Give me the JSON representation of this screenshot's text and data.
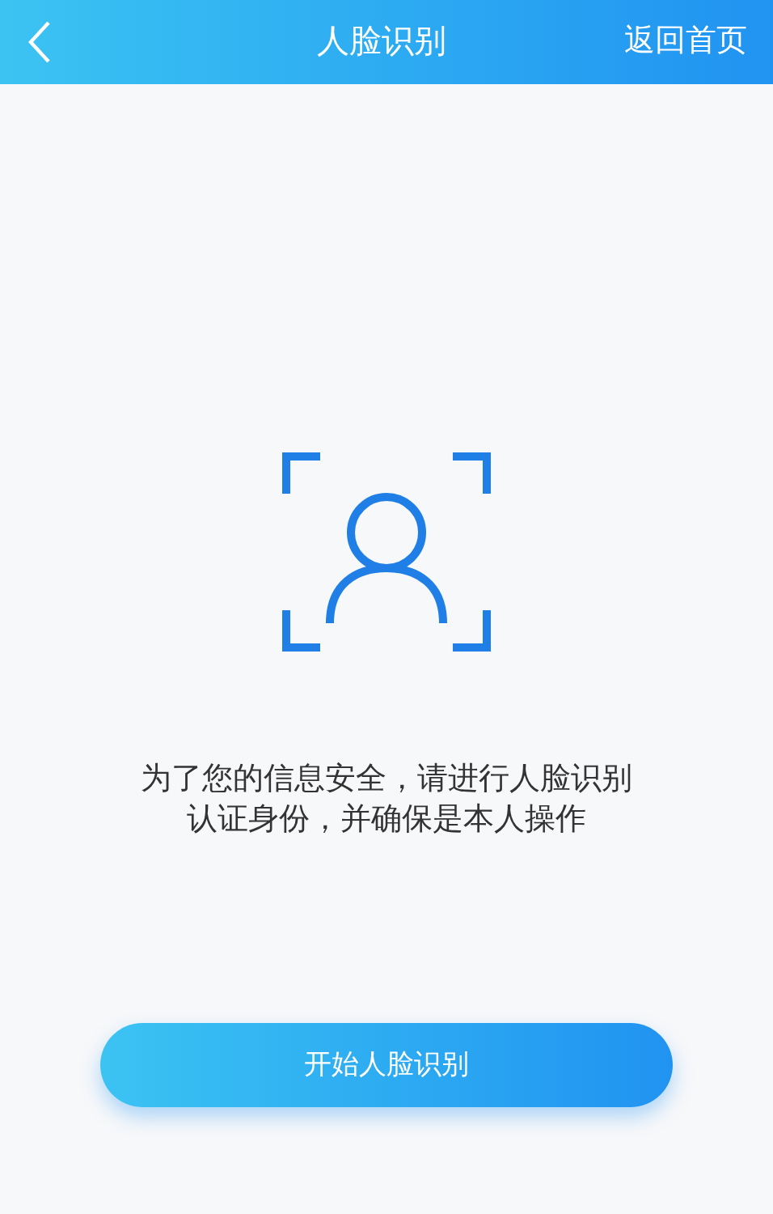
{
  "header": {
    "title": "人脸识别",
    "home_link": "返回首页"
  },
  "message": "为了您的信息安全，请进行人脸识别认证身份，并确保是本人操作",
  "start_button": "开始人脸识别"
}
